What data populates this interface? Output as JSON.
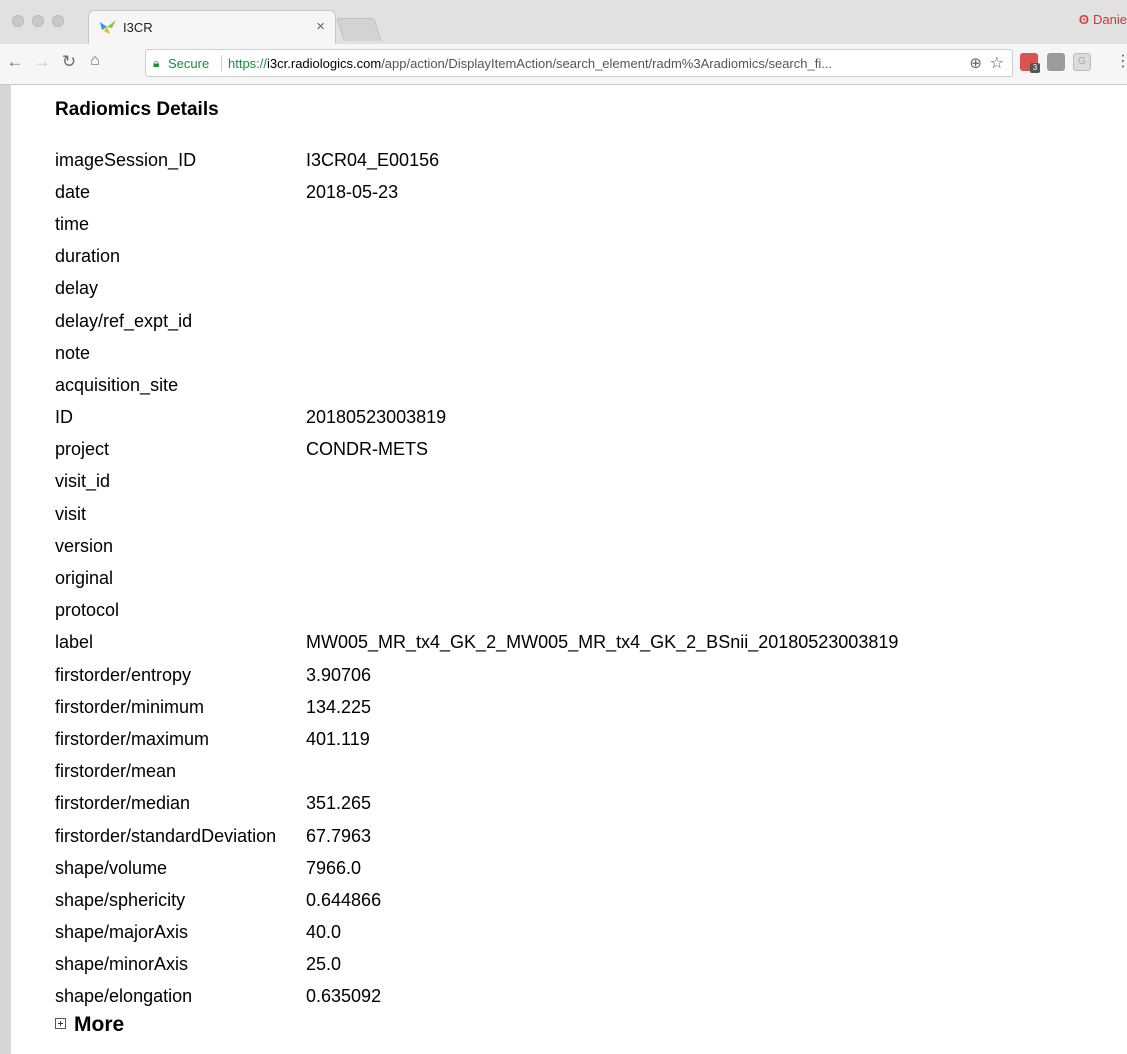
{
  "browser": {
    "tab_title": "I3CR",
    "tab_close": "×",
    "profile_name": "Danie",
    "secure_label": "Secure",
    "url_scheme": "https://",
    "url_host": "i3cr.radiologics.com",
    "url_path": "/app/action/DisplayItemAction/search_element/radm%3Aradiomics/search_fi...",
    "extension_badge": "3",
    "extension_letter": "G"
  },
  "page": {
    "heading": "Radiomics Details",
    "more_label": "More",
    "rows": [
      {
        "key": "imageSession_ID",
        "value": "I3CR04_E00156"
      },
      {
        "key": "date",
        "value": "2018-05-23"
      },
      {
        "key": "time",
        "value": ""
      },
      {
        "key": "duration",
        "value": ""
      },
      {
        "key": "delay",
        "value": ""
      },
      {
        "key": "delay/ref_expt_id",
        "value": ""
      },
      {
        "key": "note",
        "value": ""
      },
      {
        "key": "acquisition_site",
        "value": ""
      },
      {
        "key": "ID",
        "value": "20180523003819"
      },
      {
        "key": "project",
        "value": "CONDR-METS"
      },
      {
        "key": "visit_id",
        "value": ""
      },
      {
        "key": "visit",
        "value": ""
      },
      {
        "key": "version",
        "value": ""
      },
      {
        "key": "original",
        "value": ""
      },
      {
        "key": "protocol",
        "value": ""
      },
      {
        "key": "label",
        "value": "MW005_MR_tx4_GK_2_MW005_MR_tx4_GK_2_BSnii_20180523003819"
      },
      {
        "key": "firstorder/entropy",
        "value": "3.90706"
      },
      {
        "key": "firstorder/minimum",
        "value": "134.225"
      },
      {
        "key": "firstorder/maximum",
        "value": "401.119"
      },
      {
        "key": "firstorder/mean",
        "value": ""
      },
      {
        "key": "firstorder/median",
        "value": "351.265"
      },
      {
        "key": "firstorder/standardDeviation",
        "value": "67.7963"
      },
      {
        "key": "shape/volume",
        "value": "7966.0"
      },
      {
        "key": "shape/sphericity",
        "value": "0.644866"
      },
      {
        "key": "shape/majorAxis",
        "value": "40.0"
      },
      {
        "key": "shape/minorAxis",
        "value": "25.0"
      },
      {
        "key": "shape/elongation",
        "value": "0.635092"
      }
    ]
  }
}
